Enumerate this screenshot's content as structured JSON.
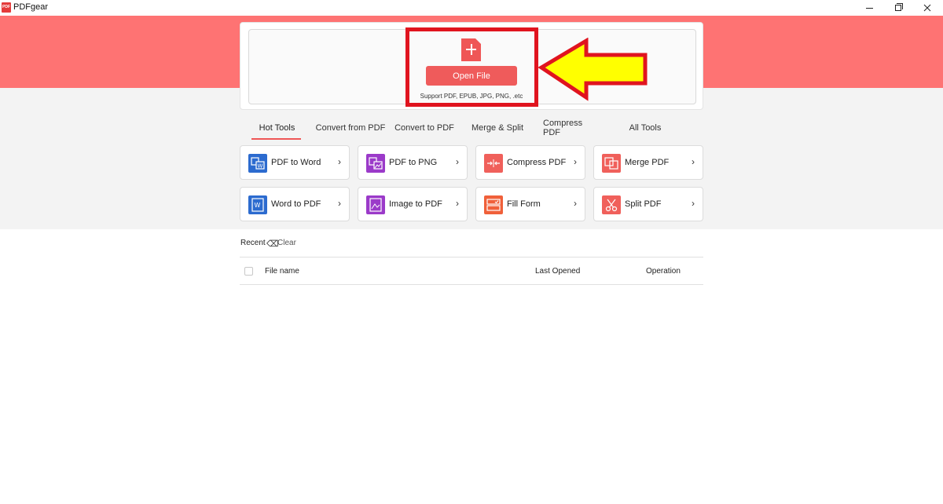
{
  "window": {
    "title": "PDFgear",
    "logo_text": "PDF",
    "controls": [
      "minimize",
      "restore",
      "close"
    ]
  },
  "drop_zone": {
    "open_button": "Open File",
    "support_text": "Support PDF, EPUB, JPG, PNG, .etc",
    "icon": "add-file-icon",
    "annotation": {
      "box_color": "#e0141f",
      "arrow_color": "#ffff00"
    }
  },
  "tabs": [
    {
      "label": "Hot Tools",
      "active": true
    },
    {
      "label": "Convert from PDF",
      "active": false
    },
    {
      "label": "Convert to PDF",
      "active": false
    },
    {
      "label": "Merge & Split",
      "active": false
    },
    {
      "label": "Compress PDF",
      "active": false
    },
    {
      "label": "All Tools",
      "active": false
    }
  ],
  "tools": [
    {
      "label": "PDF to Word",
      "icon": "pdf-to-word-icon",
      "color": "#2c6bcf"
    },
    {
      "label": "PDF to PNG",
      "icon": "pdf-to-png-icon",
      "color": "#9b3ac9"
    },
    {
      "label": "Compress PDF",
      "icon": "compress-icon",
      "color": "#f0605b"
    },
    {
      "label": "Merge PDF",
      "icon": "merge-icon",
      "color": "#f0605b"
    },
    {
      "label": "Word to PDF",
      "icon": "word-to-pdf-icon",
      "color": "#2c6bcf"
    },
    {
      "label": "Image to PDF",
      "icon": "image-to-pdf-icon",
      "color": "#9b3ac9"
    },
    {
      "label": "Fill Form",
      "icon": "fill-form-icon",
      "color": "#f0603a"
    },
    {
      "label": "Split PDF",
      "icon": "scissors-icon",
      "color": "#f0605b"
    }
  ],
  "recent": {
    "label": "Recent",
    "clear_label": "Clear",
    "columns": {
      "file_name": "File name",
      "last_opened": "Last Opened",
      "operation": "Operation"
    }
  },
  "colors": {
    "brand": "#fe7373",
    "accent": "#ef5656",
    "background": "#f3f3f3"
  }
}
